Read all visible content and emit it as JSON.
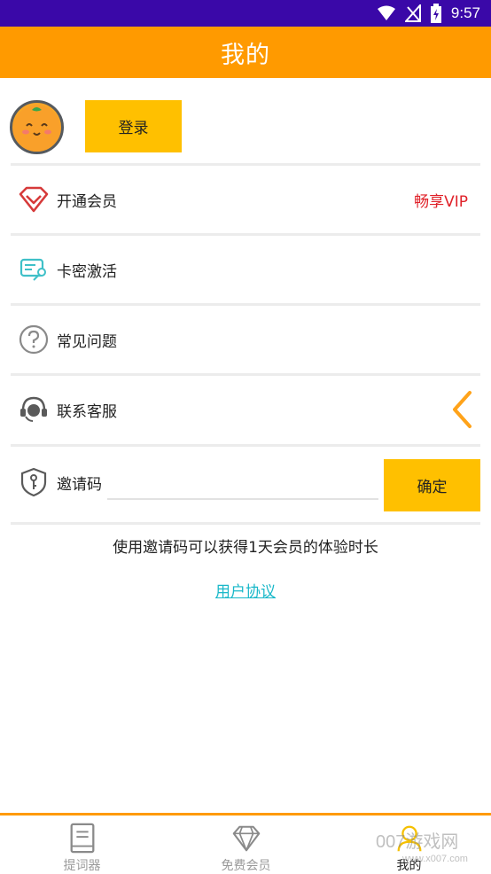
{
  "status_bar": {
    "time": "9:57",
    "bg_color": "#3a08a8",
    "icons": [
      "wifi-icon",
      "no-signal-icon",
      "battery-charging-icon"
    ]
  },
  "app_bar": {
    "title": "我的",
    "bg_color": "#ff9a00"
  },
  "profile": {
    "login_label": "登录",
    "button_color": "#ffc000"
  },
  "menu": {
    "items": [
      {
        "label": "开通会员",
        "extra": "畅享VIP",
        "icon": "vip-diamond-icon"
      },
      {
        "label": "卡密激活",
        "icon": "card-key-icon"
      },
      {
        "label": "常见问题",
        "icon": "question-icon"
      },
      {
        "label": "联系客服",
        "icon": "customer-service-icon"
      }
    ]
  },
  "invite": {
    "label": "邀请码",
    "value": "",
    "placeholder": "",
    "confirm_label": "确定",
    "icon": "shield-key-icon"
  },
  "hint": "使用邀请码可以获得1天会员的体验时长",
  "agreement_link": "用户协议",
  "tabs": [
    {
      "label": "提词器",
      "icon": "book-icon",
      "active": false
    },
    {
      "label": "免费会员",
      "icon": "diamond-icon",
      "active": false
    },
    {
      "label": "我的",
      "icon": "profile-icon",
      "active": true
    }
  ],
  "watermark": {
    "line1": "007游戏网",
    "line2": "www.x007.com"
  },
  "colors": {
    "accent": "#ff9a00",
    "button": "#ffc000",
    "vip_red": "#e0222a",
    "link": "#19b8c9"
  }
}
